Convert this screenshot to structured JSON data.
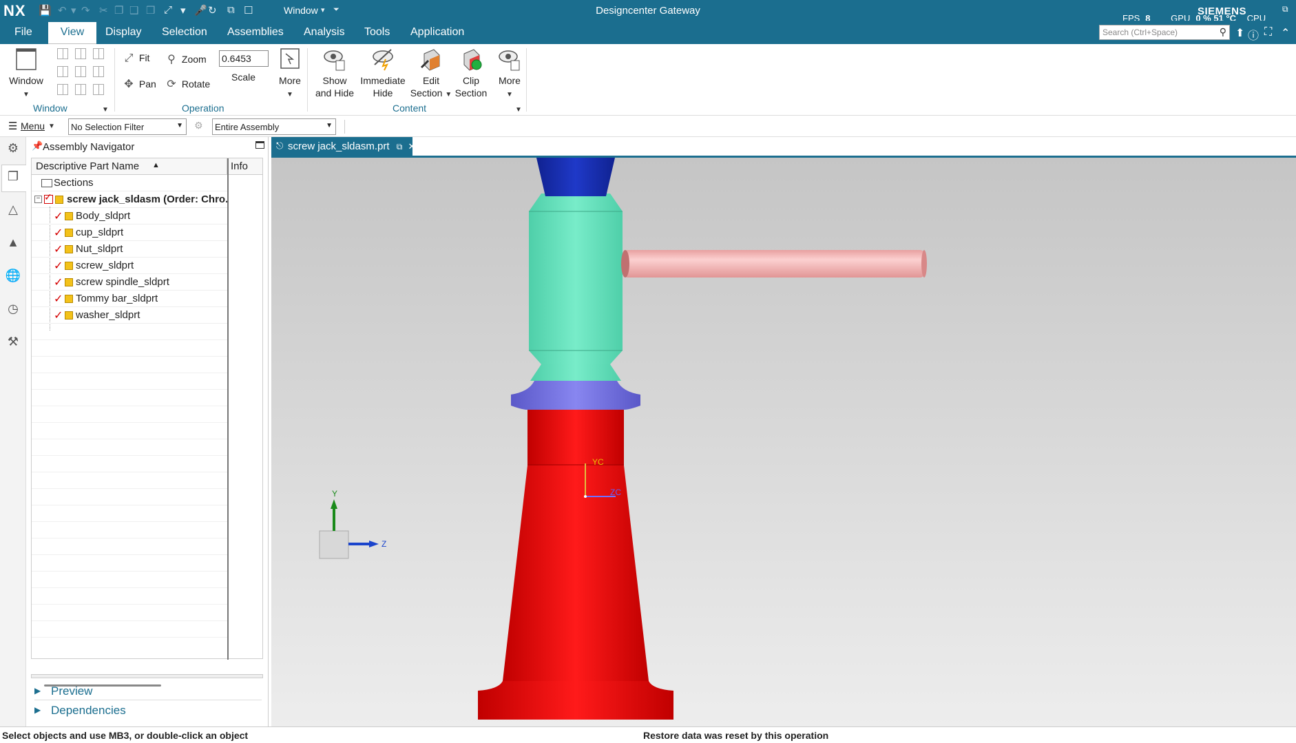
{
  "titlebar": {
    "logo": "NX",
    "window_menu": "Window",
    "app_title": "Designcenter Gateway",
    "brand": "SIEMENS",
    "fps_label": "FPS",
    "fps_value": "8",
    "gpu_label": "GPU",
    "gpu_value": "0 %",
    "gpu_temp": "51 °C",
    "cpu_label": "CPU"
  },
  "menubar": {
    "tabs": [
      "File",
      "View",
      "Display",
      "Selection",
      "Assemblies",
      "Analysis",
      "Tools",
      "Application"
    ],
    "active_tab": "View",
    "search_placeholder": "Search (Ctrl+Space)"
  },
  "ribbon": {
    "window_group": {
      "label": "Window",
      "button": "Window"
    },
    "operation_group": {
      "label": "Operation",
      "fit": "Fit",
      "zoom": "Zoom",
      "pan": "Pan",
      "rotate": "Rotate",
      "scale_value": "0.6453",
      "scale_label": "Scale",
      "more": "More"
    },
    "content_group": {
      "label": "Content",
      "show_and_hide": [
        "Show",
        "and Hide"
      ],
      "immediate_hide": [
        "Immediate",
        "Hide"
      ],
      "edit_section": [
        "Edit",
        "Section"
      ],
      "clip_section": [
        "Clip",
        "Section"
      ],
      "more": "More"
    }
  },
  "toolbar2": {
    "menu": "Menu",
    "selection_filter": "No Selection Filter",
    "scope": "Entire Assembly"
  },
  "navigator": {
    "title": "Assembly Navigator",
    "col_name": "Descriptive Part Name",
    "col_info": "Info",
    "sections": "Sections",
    "root": "screw jack_sldasm (Order: Chro...",
    "parts": [
      "Body_sldprt",
      "cup_sldprt",
      "Nut_sldprt",
      "screw_sldprt",
      "screw spindle_sldprt",
      "Tommy bar_sldprt",
      "washer_sldprt"
    ],
    "preview": "Preview",
    "dependencies": "Dependencies"
  },
  "graphics": {
    "tab_title": "screw jack_sldasm.prt",
    "wcs_y": "Y",
    "wcs_z": "Z",
    "csys_yc": "YC",
    "csys_zc": "ZC"
  },
  "status": {
    "left": "Select objects and use MB3, or double-click an object",
    "middle": "Restore data was reset by this operation"
  },
  "colors": {
    "brand": "#1b6e8f",
    "cup": "#1a2fb8",
    "nut": "#6ee8c4",
    "tommy_bar": "#f8b8b8",
    "washer": "#7a78e8",
    "body": "#ee1111"
  }
}
